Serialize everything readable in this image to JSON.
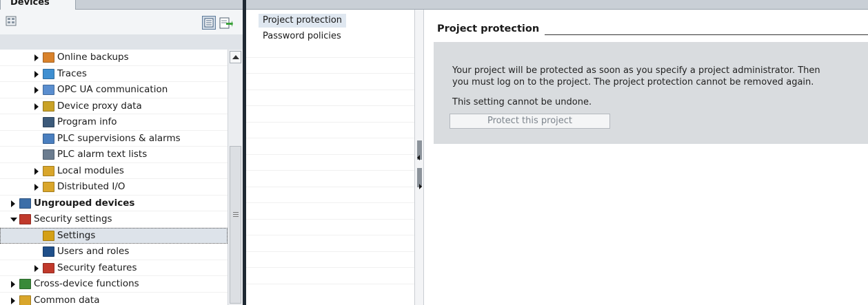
{
  "left_pane": {
    "tab_label": "Devices",
    "tree": [
      {
        "label": "Online backups",
        "indent": 2,
        "expander": "right",
        "icon": "online-backups-icon",
        "icon_color": "#d9822b",
        "bold": false
      },
      {
        "label": "Traces",
        "indent": 2,
        "expander": "right",
        "icon": "traces-icon",
        "icon_color": "#3f8fd1",
        "bold": false
      },
      {
        "label": "OPC UA communication",
        "indent": 2,
        "expander": "right",
        "icon": "opc-ua-icon",
        "icon_color": "#5a8ecf",
        "bold": false
      },
      {
        "label": "Device proxy data",
        "indent": 2,
        "expander": "right",
        "icon": "device-proxy-icon",
        "icon_color": "#c9a227",
        "bold": false
      },
      {
        "label": "Program info",
        "indent": 2,
        "expander": "none",
        "icon": "program-info-icon",
        "icon_color": "#3c5a7a",
        "bold": false
      },
      {
        "label": "PLC supervisions & alarms",
        "indent": 2,
        "expander": "none",
        "icon": "plc-supervisions-icon",
        "icon_color": "#4a7fbf",
        "bold": false
      },
      {
        "label": "PLC alarm text lists",
        "indent": 2,
        "expander": "none",
        "icon": "alarm-text-lists-icon",
        "icon_color": "#6b7c8f",
        "bold": false
      },
      {
        "label": "Local modules",
        "indent": 2,
        "expander": "right",
        "icon": "local-modules-icon",
        "icon_color": "#d9a62b",
        "bold": false
      },
      {
        "label": "Distributed I/O",
        "indent": 2,
        "expander": "right",
        "icon": "distributed-io-icon",
        "icon_color": "#d9a62b",
        "bold": false
      },
      {
        "label": "Ungrouped devices",
        "indent": 1,
        "expander": "right",
        "icon": "ungrouped-devices-icon",
        "icon_color": "#3c6ea8",
        "bold": true
      },
      {
        "label": "Security settings",
        "indent": 1,
        "expander": "down",
        "icon": "security-settings-icon",
        "icon_color": "#c0392b",
        "bold": false
      },
      {
        "label": "Settings",
        "indent": 2,
        "expander": "none",
        "icon": "settings-icon",
        "icon_color": "#d4a017",
        "bold": false,
        "selected": true
      },
      {
        "label": "Users and roles",
        "indent": 2,
        "expander": "none",
        "icon": "users-roles-icon",
        "icon_color": "#1f4f8a",
        "bold": false
      },
      {
        "label": "Security features",
        "indent": 2,
        "expander": "right",
        "icon": "security-features-icon",
        "icon_color": "#c0392b",
        "bold": false
      },
      {
        "label": "Cross-device functions",
        "indent": 1,
        "expander": "right",
        "icon": "cross-device-icon",
        "icon_color": "#3a8a3a",
        "bold": false
      },
      {
        "label": "Common data",
        "indent": 1,
        "expander": "right",
        "icon": "common-data-icon",
        "icon_color": "#d9a62b",
        "bold": false
      }
    ]
  },
  "nav": {
    "items": [
      {
        "label": "Project protection",
        "active": true
      },
      {
        "label": "Password policies",
        "active": false
      }
    ]
  },
  "content": {
    "section_title": "Project protection",
    "description_line1": "Your project will be protected as soon as you specify a project administrator. Then",
    "description_line2": "you must log on to the project. The project protection cannot be removed again.",
    "warning": "This setting cannot be undone.",
    "protect_button_label": "Protect this project",
    "protect_button_enabled": false
  }
}
